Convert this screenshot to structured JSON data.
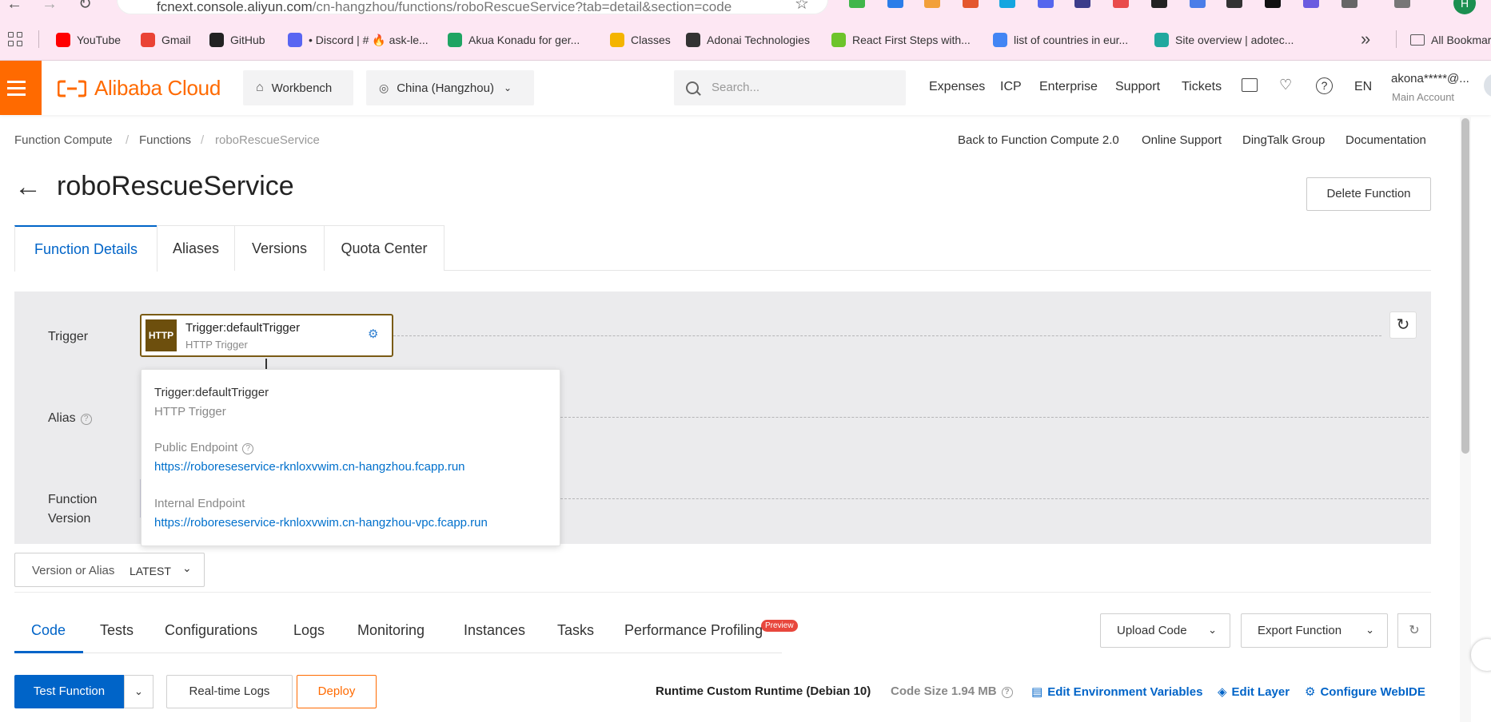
{
  "browser": {
    "url_host": "fcnext.console.aliyun.com",
    "url_path": "/cn-hangzhou/functions/roboRescueService?tab=detail&section=code",
    "profile_initial": "H",
    "bookmarks": [
      {
        "label": "YouTube",
        "icon": "youtube-icon",
        "color": "#ff0000"
      },
      {
        "label": "Gmail",
        "icon": "gmail-icon",
        "color": "#ea4335"
      },
      {
        "label": "GitHub",
        "icon": "github-icon",
        "color": "#222222"
      },
      {
        "label": "• Discord | # 🔥 ask-le...",
        "icon": "discord-icon",
        "color": "#5865f2"
      },
      {
        "label": "Akua Konadu for ger...",
        "icon": "sheets-icon",
        "color": "#1fa463"
      },
      {
        "label": "Classes",
        "icon": "emoji-icon",
        "color": "#f4b400"
      },
      {
        "label": "Adonai Technologies",
        "icon": "adonai-icon",
        "color": "#333333"
      },
      {
        "label": "React First Steps with...",
        "icon": "react-course-icon",
        "color": "#6dc42b"
      },
      {
        "label": "list of countries in eur...",
        "icon": "google-icon",
        "color": "#4285f4"
      },
      {
        "label": "Site overview | adotec...",
        "icon": "netlify-icon",
        "color": "#20a89e"
      }
    ],
    "all_bookmarks_label": "All Bookmarks"
  },
  "header": {
    "brand": "Alibaba Cloud",
    "workbench": "Workbench",
    "region": "China (Hangzhou)",
    "search_placeholder": "Search...",
    "links": [
      "Expenses",
      "ICP",
      "Enterprise",
      "Support",
      "Tickets"
    ],
    "language": "EN",
    "account_name": "akona*****@...",
    "account_role": "Main Account"
  },
  "breadcrumb": [
    "Function Compute",
    "Functions",
    "roboRescueService"
  ],
  "top_links": [
    "Back to Function Compute 2.0",
    "Online Support",
    "DingTalk Group",
    "Documentation"
  ],
  "title": "roboRescueService",
  "delete_label": "Delete Function",
  "page_tabs": [
    "Function Details",
    "Aliases",
    "Versions",
    "Quota Center"
  ],
  "topology": {
    "row_trigger": "Trigger",
    "row_alias": "Alias",
    "row_version_1": "Function",
    "row_version_2": "Version",
    "trigger_badge": "HTTP",
    "trigger_name": "Trigger:defaultTrigger",
    "trigger_type": "HTTP Trigger"
  },
  "popover": {
    "name": "Trigger:defaultTrigger",
    "type": "HTTP Trigger",
    "public_label": "Public Endpoint",
    "public_url": "https://roboreseservice-rknloxvwim.cn-hangzhou.fcapp.run",
    "internal_label": "Internal Endpoint",
    "internal_url": "https://roboreseservice-rknloxvwim.cn-hangzhou-vpc.fcapp.run"
  },
  "version_select": {
    "label": "Version or Alias",
    "value": "LATEST"
  },
  "sub_tabs": [
    "Code",
    "Tests",
    "Configurations",
    "Logs",
    "Monitoring",
    "Instances",
    "Tasks",
    "Performance Profiling"
  ],
  "preview_badge": "Preview",
  "upload_label": "Upload Code",
  "export_label": "Export Function",
  "actions": {
    "test": "Test Function",
    "logs": "Real-time Logs",
    "deploy": "Deploy"
  },
  "runtime": {
    "runtime_label": "Runtime Custom Runtime (Debian 10)",
    "code_size": "Code Size 1.94 MB",
    "env_vars": "Edit Environment Variables",
    "edit_layer": "Edit Layer",
    "webide": "Configure WebIDE"
  },
  "colors": {
    "brand_orange": "#ff6a00",
    "primary_blue": "#0064c8",
    "http_brown": "#6d4f0d"
  }
}
